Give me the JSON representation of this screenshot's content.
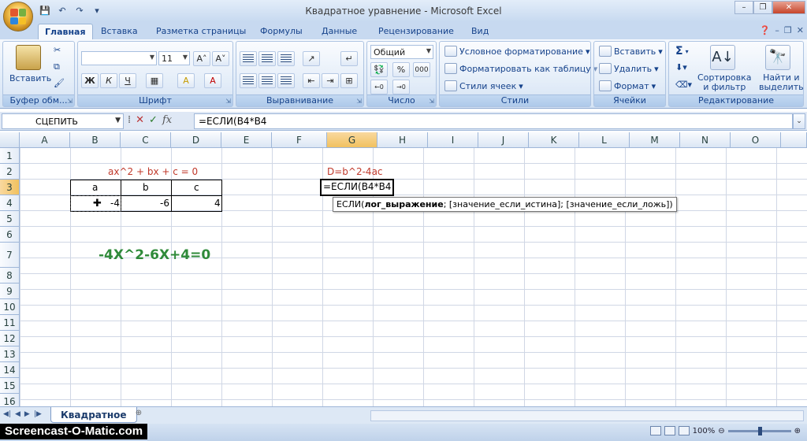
{
  "window": {
    "title": "Квадратное уравнение - Microsoft Excel",
    "controls": [
      "–",
      "❐",
      "✕"
    ]
  },
  "tabs": [
    "Главная",
    "Вставка",
    "Разметка страницы",
    "Формулы",
    "Данные",
    "Рецензирование",
    "Вид"
  ],
  "ribbon": {
    "clipboard": {
      "label": "Буфер обм...",
      "paste": "Вставить"
    },
    "font": {
      "label": "Шрифт",
      "font_name": "",
      "font_size": "11",
      "grow": "A˄",
      "shrink": "A˅",
      "bold": "Ж",
      "italic": "К",
      "underline": "Ч",
      "fill": "A",
      "color": "A"
    },
    "alignment": {
      "label": "Выравнивание"
    },
    "number": {
      "label": "Число",
      "format": "Общий",
      "percent": "%",
      "thousands": "000"
    },
    "styles": {
      "label": "Стили",
      "conditional": "Условное форматирование",
      "as_table": "Форматировать как таблицу",
      "cell_styles": "Стили ячеек"
    },
    "cells": {
      "label": "Ячейки",
      "insert": "Вставить",
      "delete": "Удалить",
      "format": "Формат"
    },
    "editing": {
      "label": "Редактирование",
      "sum": "Σ",
      "sort_line1": "Сортировка",
      "sort_line2": "и фильтр",
      "find_line1": "Найти и",
      "find_line2": "выделить"
    }
  },
  "formula_bar": {
    "name_box": "СЦЕПИТЬ",
    "fx": "fx",
    "formula": "=ЕСЛИ(B4*B4"
  },
  "columns": [
    "A",
    "B",
    "C",
    "D",
    "E",
    "F",
    "G",
    "H",
    "I",
    "J",
    "K",
    "L",
    "M",
    "N",
    "O"
  ],
  "rows": [
    "1",
    "2",
    "3",
    "4",
    "5",
    "6",
    "7",
    "8",
    "9",
    "10",
    "11",
    "12",
    "13",
    "14",
    "15",
    "16"
  ],
  "sheet": {
    "b2": "ax^2 + bx + c = 0",
    "b3": "a",
    "c3": "b",
    "d3": "c",
    "b4": "-4",
    "c4": "-6",
    "d4": "4",
    "g2": "D=b^2-4ac",
    "g3_edit": "=ЕСЛИ(B4*B4",
    "b7": "-4X^2-6X+4=0",
    "tooltip_fn": "ЕСЛИ(",
    "tooltip_arg1": "лог_выражение",
    "tooltip_rest": "; [значение_если_истина]; [значение_если_ложь])"
  },
  "sheet_tabs": {
    "active": "Квадратное"
  },
  "status": {
    "watermark": "Screencast-O-Matic.com",
    "zoom": "100%"
  },
  "colors": {
    "accent": "#15428b",
    "red_text": "#c0392b",
    "green_text": "#2f8a3a"
  }
}
